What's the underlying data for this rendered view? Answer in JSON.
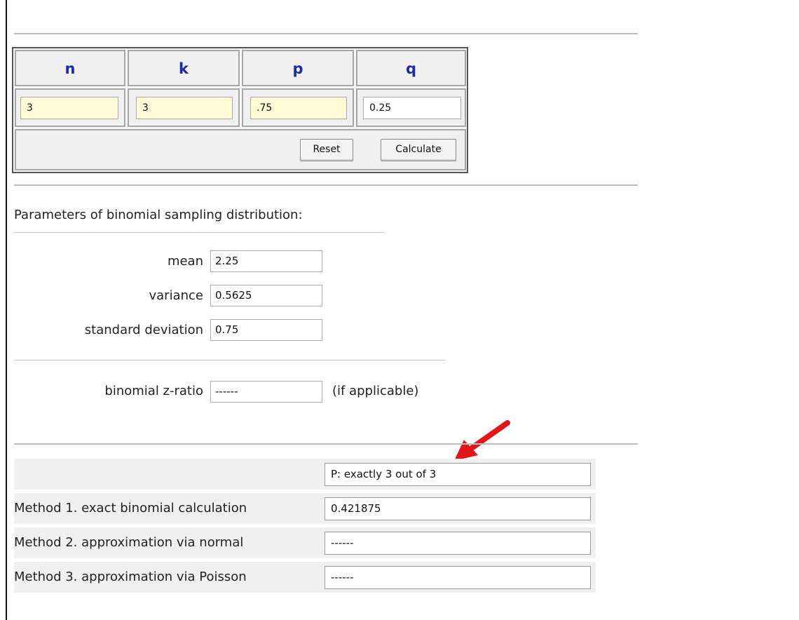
{
  "table": {
    "headers": [
      "n",
      "k",
      "p",
      "q"
    ],
    "values": [
      "3",
      "3",
      ".75",
      "0.25"
    ]
  },
  "buttons": {
    "reset": "Reset",
    "calculate": "Calculate"
  },
  "params": {
    "title": "Parameters of binomial sampling distribution:",
    "mean_label": "mean",
    "mean_value": "2.25",
    "variance_label": "variance",
    "variance_value": "0.5625",
    "sd_label": "standard deviation",
    "sd_value": "0.75",
    "z_label": "binomial z-ratio",
    "z_value": "------",
    "z_note": "(if applicable)"
  },
  "results": {
    "header_value": "P: exactly 3 out of 3",
    "rows": [
      {
        "label": "Method 1. exact binomial calculation",
        "value": "0.421875"
      },
      {
        "label": "Method 2. approximation via normal",
        "value": "------"
      },
      {
        "label": "Method 3. approximation via Poisson",
        "value": "------"
      }
    ]
  },
  "colors": {
    "header_text": "#1e2aa0",
    "input_highlight": "#fffbd6",
    "arrow": "#e11717"
  },
  "icons": {
    "annotation_arrow": "red-arrow-icon"
  }
}
